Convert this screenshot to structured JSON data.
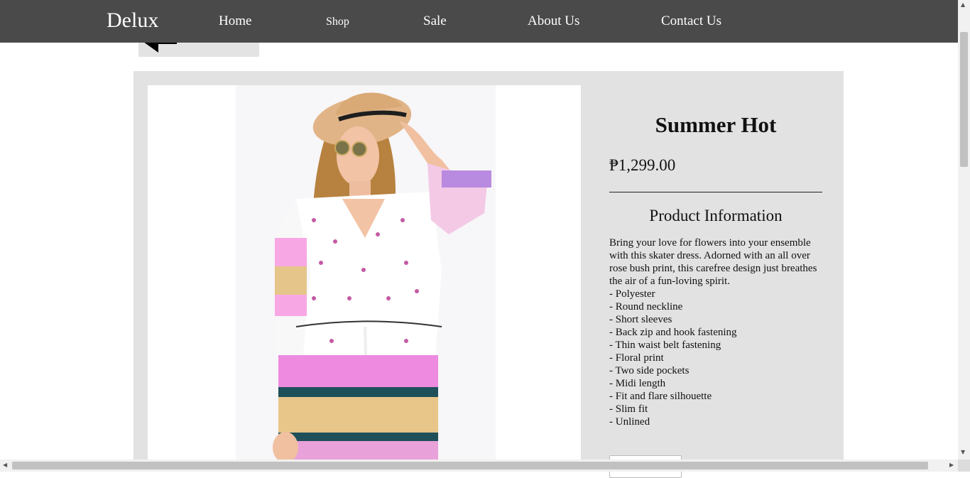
{
  "nav": {
    "brand": "Delux",
    "links": [
      "Home",
      "Shop",
      "Sale",
      "About Us",
      "Contact Us"
    ]
  },
  "back_button": {
    "icon": "arrow-left-icon"
  },
  "product": {
    "title": "Summer Hot",
    "price": "₱1,299.00",
    "info_heading": "Product Information",
    "description": "Bring your love for flowers into your ensemble with this skater dress. Adorned with an all over rose bush print, this carefree design just breathes the air of a fun-loving spirit.",
    "features": [
      "- Polyester",
      "- Round neckline",
      "- Short sleeves",
      "- Back zip and hook fastening",
      "- Thin waist belt fastening",
      "- Floral print",
      "- Two side pockets",
      "- Midi length",
      "- Fit and flare silhouette",
      "- Slim fit",
      "- Unlined"
    ]
  },
  "colors": {
    "navbar": "#4a4a4a",
    "panel": "#e2e2e2"
  }
}
